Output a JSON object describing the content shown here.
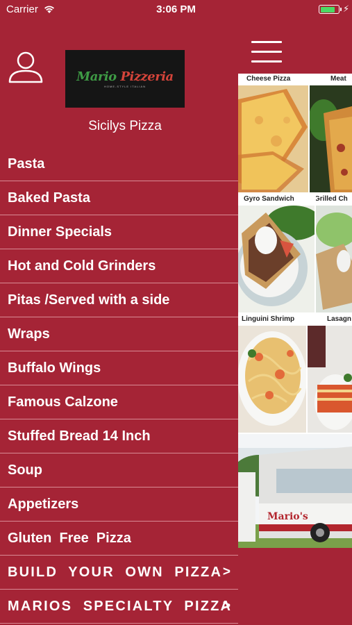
{
  "status_bar": {
    "carrier": "Carrier",
    "time": "3:06 PM",
    "battery_level": 0.85
  },
  "drawer": {
    "logo_text_green": "Mario",
    "logo_text_red": " Pizzeria",
    "logo_subtitle": "HOME-STYLE ITALIAN",
    "store_name": "Sicilys Pizza",
    "items": [
      {
        "label": "Pasta"
      },
      {
        "label": "Baked Pasta"
      },
      {
        "label": "Dinner Specials"
      },
      {
        "label": "Hot and Cold Grinders"
      },
      {
        "label": "Pitas /Served with a side"
      },
      {
        "label": "Wraps"
      },
      {
        "label": "Buffalo Wings"
      },
      {
        "label": "Famous Calzone"
      },
      {
        "label": "Stuffed Bread 14 Inch"
      },
      {
        "label": "Soup"
      },
      {
        "label": "Appetizers"
      },
      {
        "label": "Gluten  Free  Pizza"
      },
      {
        "label": "BUILD  YOUR  OWN  PIZZA",
        "chevron": ">"
      },
      {
        "label": "MARIOS  SPECIALTY  PIZZA",
        "chevron": ">"
      }
    ]
  },
  "main": {
    "tiles": [
      {
        "caption": "Cheese Pizza"
      },
      {
        "caption": "Meat"
      },
      {
        "caption": "Gyro Sandwich"
      },
      {
        "caption": "Grilled Ch"
      },
      {
        "caption": "Linguini Shrimp"
      },
      {
        "caption": "Lasagn"
      }
    ],
    "truck_sign": "Mario's"
  },
  "colors": {
    "brand_red": "#a52436",
    "divider": "#d98b95",
    "battery_green": "#4cd964",
    "logo_green": "#3e9b45"
  }
}
